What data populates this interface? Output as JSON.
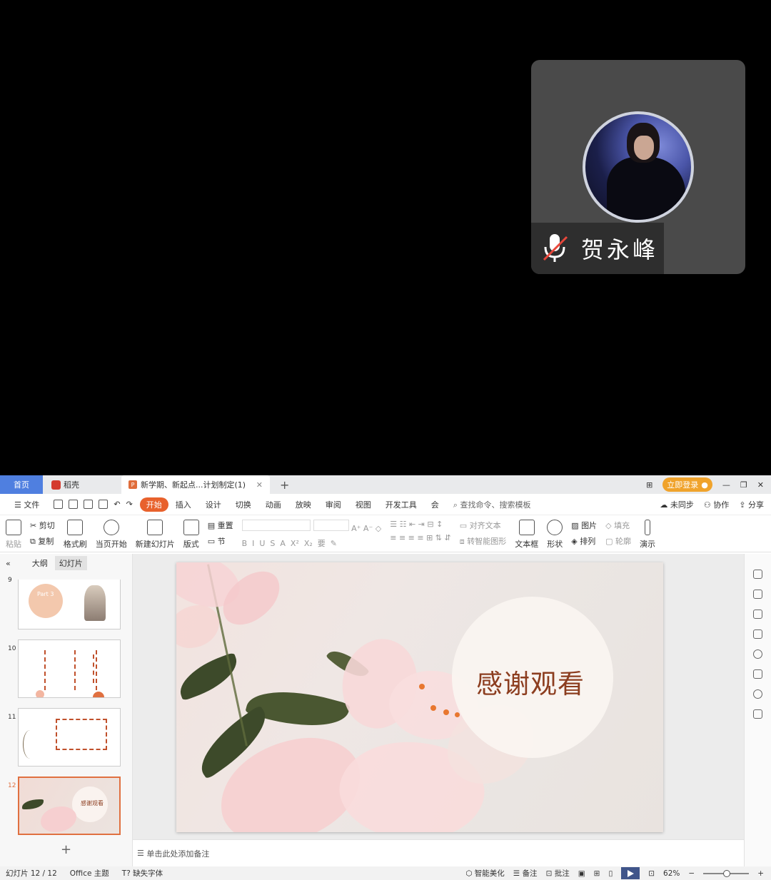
{
  "participant": {
    "name": "贺永峰",
    "mic_state": "muted"
  },
  "tabs": {
    "home": "首页",
    "daoke": "稻壳",
    "doc": "新学期、新起点...计划制定(1)",
    "login": "立即登录"
  },
  "menu": {
    "items": [
      "文件",
      "开始",
      "插入",
      "设计",
      "切换",
      "动画",
      "放映",
      "审阅",
      "视图",
      "开发工具",
      "会"
    ],
    "search": "查找命令、搜索模板",
    "right": [
      "未同步",
      "协作",
      "分享"
    ]
  },
  "ribbon": {
    "paste": "粘贴",
    "cut": "剪切",
    "copy": "复制",
    "format_painter": "格式刷",
    "from_current": "当页开始",
    "new_slide": "新建幻灯片",
    "layout": "版式",
    "reset": "重置",
    "section": "节",
    "align_text": "对齐文本",
    "smart_art": "转智能图形",
    "textbox": "文本框",
    "shape": "形状",
    "picture": "图片",
    "fill": "填充",
    "arrange": "排列",
    "outline": "轮廓",
    "present": "演示"
  },
  "sidebar": {
    "tab_outline": "大纲",
    "tab_slides": "幻灯片",
    "slides": [
      {
        "num": "9",
        "text": "Part 3"
      },
      {
        "num": "10",
        "text": ""
      },
      {
        "num": "11",
        "text": ""
      },
      {
        "num": "12",
        "text": "感谢观看"
      }
    ]
  },
  "slide": {
    "title": "感谢观看"
  },
  "notes": {
    "placeholder": "单击此处添加备注"
  },
  "status": {
    "slide_count": "幻灯片 12 / 12",
    "theme": "Office 主题",
    "missing_font": "缺失字体",
    "beautify": "智能美化",
    "notes": "备注",
    "comments": "批注",
    "zoom": "62%"
  }
}
